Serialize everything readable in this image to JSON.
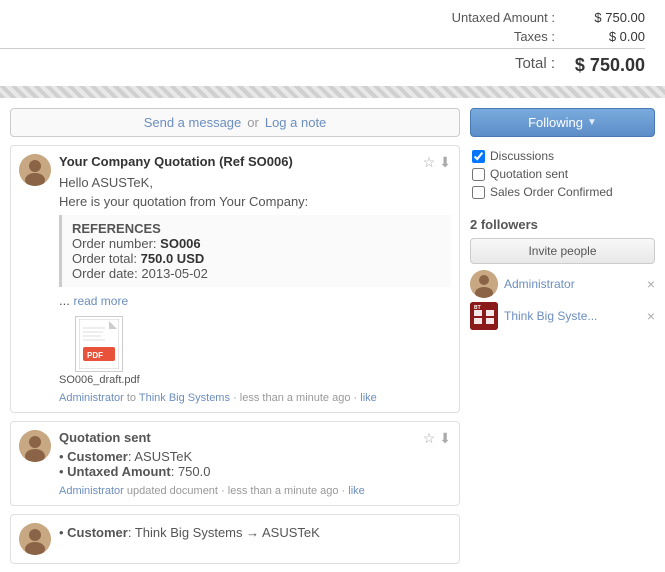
{
  "summary": {
    "untaxed_label": "Untaxed Amount :",
    "untaxed_value": "$ 750.00",
    "taxes_label": "Taxes :",
    "taxes_value": "$ 0.00",
    "total_label": "Total :",
    "total_value": "$ 750.00"
  },
  "tabs": {
    "send_message": "Send a message",
    "or": "or",
    "log_note": "Log a note"
  },
  "messages": [
    {
      "id": "msg1",
      "title": "Your Company Quotation (Ref SO006)",
      "body_line1": "Hello ASUSTeK,",
      "body_line2": "Here is your quotation from Your Company:",
      "references": {
        "title": "REFERENCES",
        "order_number_label": "Order number:",
        "order_number_value": "SO006",
        "order_total_label": "Order total:",
        "order_total_value": "750.0 USD",
        "order_date_label": "Order date:",
        "order_date_value": "2013-05-02"
      },
      "read_more": "read more",
      "attachment_name": "SO006_draft.pdf",
      "footer": {
        "author": "Administrator",
        "to": "to",
        "company": "Think Big Systems",
        "time": "less than a minute ago",
        "like": "like"
      }
    }
  ],
  "simple_messages": [
    {
      "id": "msg2",
      "title": "Quotation sent",
      "items": [
        {
          "label": "Customer",
          "value": "ASUSTeK"
        },
        {
          "label": "Untaxed Amount",
          "value": "750.0"
        }
      ],
      "footer": {
        "author": "Administrator",
        "action": "updated document",
        "time": "less than a minute ago",
        "like": "like"
      }
    },
    {
      "id": "msg3",
      "items": [
        {
          "label": "Customer",
          "value": "Think Big Systems → ASUSTeK"
        }
      ]
    }
  ],
  "sidebar": {
    "following_label": "Following",
    "checkboxes": [
      {
        "id": "cb_discussions",
        "label": "Discussions",
        "checked": true
      },
      {
        "id": "cb_quotation",
        "label": "Quotation sent",
        "checked": false
      },
      {
        "id": "cb_sales_order",
        "label": "Sales Order Confirmed",
        "checked": false
      }
    ],
    "followers_count": "2 followers",
    "invite_btn": "Invite people",
    "followers": [
      {
        "name": "Administrator",
        "type": "person"
      },
      {
        "name": "Think Big Syste...",
        "type": "company"
      }
    ]
  }
}
